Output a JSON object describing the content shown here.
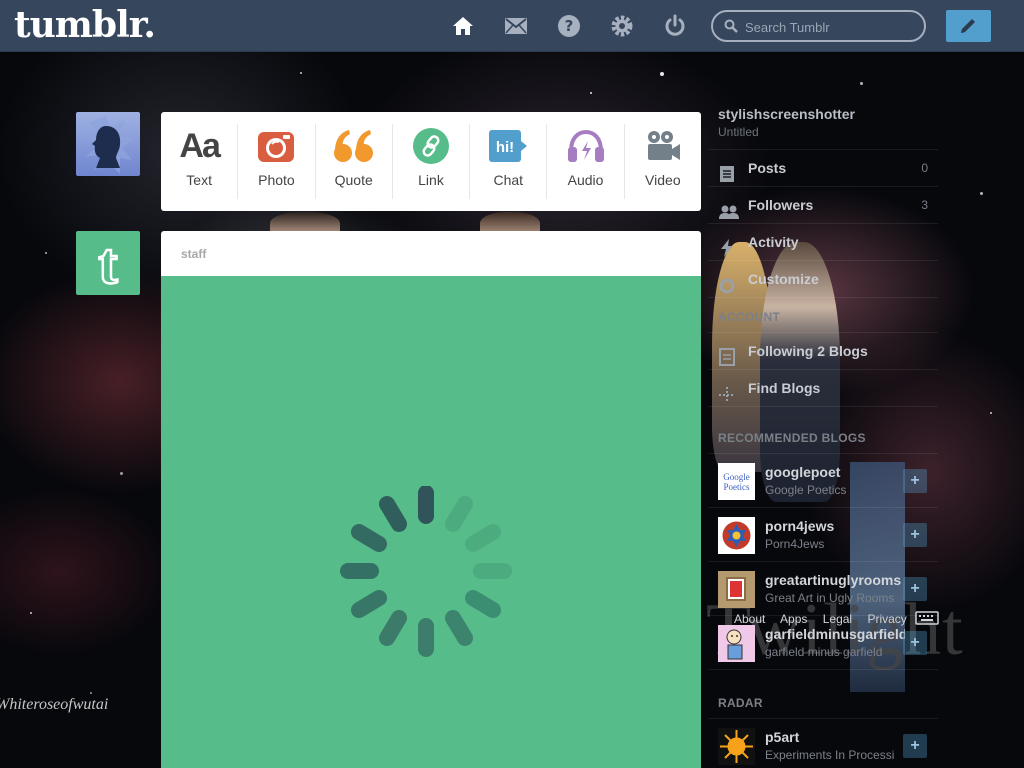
{
  "header": {
    "logo": "tumblr.",
    "search_placeholder": "Search Tumblr",
    "nav_icons": [
      "home-icon",
      "mail-icon",
      "help-icon",
      "settings-icon",
      "power-icon"
    ],
    "compose_icon": "pencil-icon"
  },
  "post_types": [
    {
      "label": "Text",
      "icon": "text-icon",
      "glyph": "Aa",
      "color": "#444444"
    },
    {
      "label": "Photo",
      "icon": "camera-icon",
      "color": "#d95e40"
    },
    {
      "label": "Quote",
      "icon": "quote-icon",
      "glyph": "“",
      "color": "#f2992e"
    },
    {
      "label": "Link",
      "icon": "link-icon",
      "color": "#56bc8a"
    },
    {
      "label": "Chat",
      "icon": "chat-icon",
      "glyph": "hi!",
      "color": "#529ecc"
    },
    {
      "label": "Audio",
      "icon": "headphones-icon",
      "color": "#a77dc2"
    },
    {
      "label": "Video",
      "icon": "video-camera-icon",
      "color": "#748089"
    }
  ],
  "post": {
    "author": "staff"
  },
  "sidebar": {
    "blog_name": "stylishscreenshotter",
    "blog_sub": "Untitled",
    "items": [
      {
        "label": "Posts",
        "count": "0",
        "icon": "posts-icon"
      },
      {
        "label": "Followers",
        "count": "3",
        "icon": "followers-icon"
      },
      {
        "label": "Activity",
        "count": "",
        "icon": "activity-icon"
      },
      {
        "label": "Customize",
        "count": "",
        "icon": "customize-icon"
      }
    ],
    "account_heading": "ACCOUNT",
    "account_items": [
      {
        "label": "Following 2 Blogs",
        "icon": "following-icon"
      },
      {
        "label": "Find Blogs",
        "icon": "find-blogs-icon"
      }
    ],
    "recommended_heading": "RECOMMENDED BLOGS",
    "recommended": [
      {
        "name": "googlepoet",
        "sub": "Google Poetics",
        "thumb_text": "Google Poetics"
      },
      {
        "name": "porn4jews",
        "sub": "Porn4Jews"
      },
      {
        "name": "greatartinuglyrooms",
        "sub": "Great Art in Ugly Rooms"
      },
      {
        "name": "garfieldminusgarfield",
        "sub": "garfield minus garfield"
      }
    ],
    "radar_heading": "RADAR",
    "radar": {
      "name": "p5art",
      "sub": "Experiments In Processing"
    },
    "follow_label": "+",
    "footer_links": [
      "About",
      "Apps",
      "Legal",
      "Privacy"
    ]
  },
  "background": {
    "banner_text": "Twilight",
    "watermark": "Whiteroseofwutai"
  }
}
